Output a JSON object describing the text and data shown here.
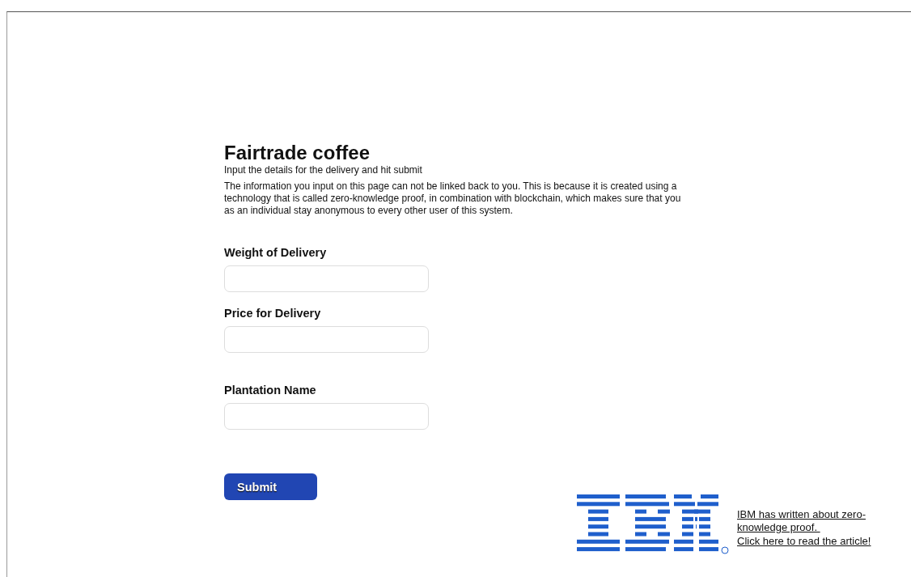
{
  "title": "Fairtrade coffee",
  "subtitle": "Input the details for the delivery and hit submit",
  "description": "The information you input on this page can not be linked back to you. This is because it is created using a technology that is called zero-knowledge proof, in combination with blockchain, which makes sure that you as an individual stay anonymous to every other user of this system.",
  "fields": [
    {
      "label": "Weight of Delivery"
    },
    {
      "label": "Price for Delivery"
    },
    {
      "label": "Plantation Name"
    }
  ],
  "submit_button": "Submit",
  "article_link": [
    "IBM has written about zero-",
    "knowledge proof. ",
    "Click here to read the article!"
  ]
}
